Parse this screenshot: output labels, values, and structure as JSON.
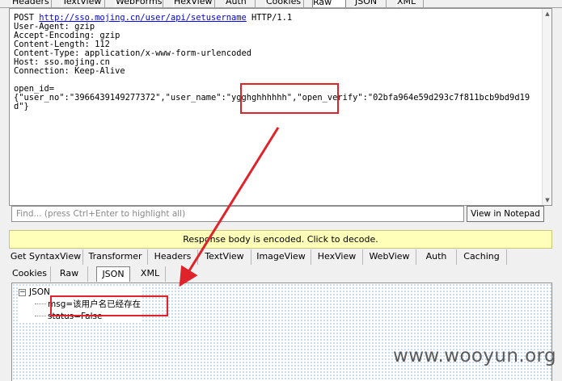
{
  "request_tabs": [
    "Headers",
    "TextView",
    "WebForms",
    "HexView",
    "Auth",
    "Cookies",
    "Raw",
    "JSON",
    "XML"
  ],
  "request": {
    "method": "POST",
    "url": "http://sso.mojing.cn/user/api/setusername",
    "protocol": "HTTP/1.1",
    "headers": [
      "User-Agent: gzip",
      "Accept-Encoding: gzip",
      "Content-Length: 112",
      "Content-Type: application/x-www-form-urlencoded",
      "Host: sso.mojing.cn",
      "Connection: Keep-Alive"
    ],
    "body_label": "open_id=",
    "body_json": "{\"user_no\":\"3966439149277372\",\"user_name\":\"ygghghhhhhh\",\"open_verify\":\"02bfa964e59d293c7f811bcb9bd9d19d\"}"
  },
  "find_bar": {
    "placeholder": "Find... (press Ctrl+Enter to highlight all)"
  },
  "notepad_button": "View in Notepad",
  "encoded_banner": "Response body is encoded. Click to decode.",
  "response_tabs_row1": [
    "Get SyntaxView",
    "Transformer",
    "Headers",
    "TextView",
    "ImageView",
    "HexView",
    "WebView",
    "Auth",
    "Caching"
  ],
  "response_tabs_row2": [
    "Cookies",
    "Raw",
    "JSON",
    "XML"
  ],
  "response_active_tab": "JSON",
  "json_tree": {
    "root": "JSON",
    "expander": "−",
    "children": [
      "msg=该用户名已经存在",
      "status=False"
    ]
  },
  "watermark": "www.wooyun.org",
  "colors": {
    "annotation": "#e0232a",
    "banner": "#ffffb9",
    "link": "#0000ee"
  }
}
